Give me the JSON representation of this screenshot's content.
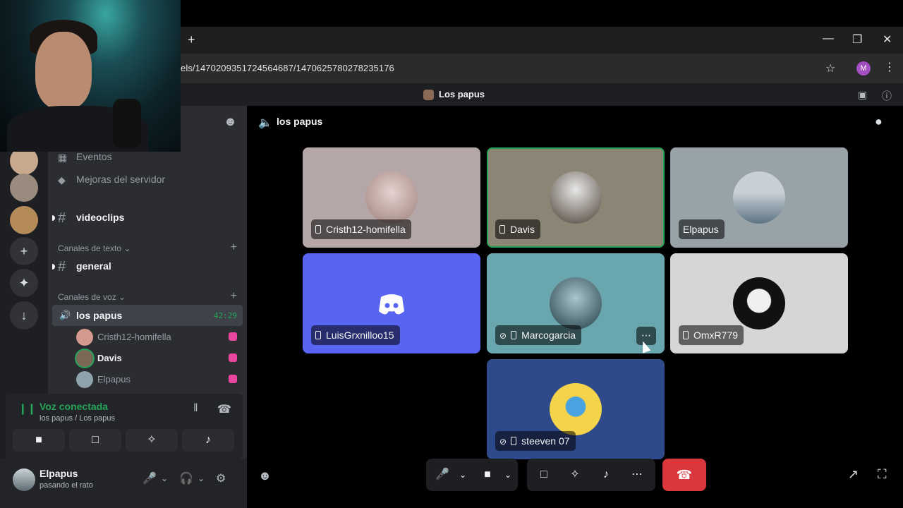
{
  "browser": {
    "url": "els/1470209351724564687/1470625780278235176",
    "profile_initial": "M",
    "new_tab_icon": "plus-icon"
  },
  "window": {
    "title": "Los papus"
  },
  "sidebar": {
    "items": [
      {
        "label": "Eventos",
        "icon": "calendar-icon"
      },
      {
        "label": "Mejoras del servidor",
        "icon": "boost-icon"
      }
    ],
    "channels_top": [
      {
        "name": "videoclips"
      }
    ],
    "text_category": "Canales de texto",
    "text_channels": [
      {
        "name": "general"
      }
    ],
    "voice_category": "Canales de voz",
    "voice_channel": {
      "name": "los papus",
      "timer": "42:29",
      "users": [
        {
          "name": "Cristh12-homifella",
          "avatar_color": "#d59a8f"
        },
        {
          "name": "Davis",
          "avatar_color": "#7a6a55"
        },
        {
          "name": "Elpapus",
          "avatar_color": "#8fa3ad"
        }
      ]
    }
  },
  "voice_panel": {
    "status": "Voz conectada",
    "location": "los papus / Los papus"
  },
  "user": {
    "name": "Elpapus",
    "status": "pasando el rato"
  },
  "call": {
    "channel": "los papus",
    "participants": [
      {
        "name": "Cristh12-homifella",
        "bg": "#b5a7a8",
        "avatar": "#c9b8b6",
        "muted": false,
        "speaking": false
      },
      {
        "name": "Davis",
        "bg": "#8a8574",
        "avatar": "#6b5d4c",
        "muted": false,
        "speaking": true
      },
      {
        "name": "Elpapus",
        "bg": "#98a3a8",
        "avatar": "#b6c3ca",
        "muted": false,
        "speaking": false
      },
      {
        "name": "LuisGrxnilloo15",
        "bg": "#5865f2",
        "avatar": "#5865f2",
        "muted": false,
        "speaking": false
      },
      {
        "name": "Marcogarcia",
        "bg": "#6aa6ae",
        "avatar": "#2f5f6a",
        "muted": true,
        "speaking": false
      },
      {
        "name": "OmxR779",
        "bg": "#d6d6d6",
        "avatar": "#1a1a1a",
        "muted": false,
        "speaking": false
      },
      {
        "name": "steeven 07",
        "bg": "#2f4a8a",
        "avatar": "#f3d34a",
        "muted": true,
        "speaking": false
      }
    ]
  },
  "accent": {
    "green": "#23a55a",
    "red": "#da373c",
    "blurple": "#5865f2"
  }
}
